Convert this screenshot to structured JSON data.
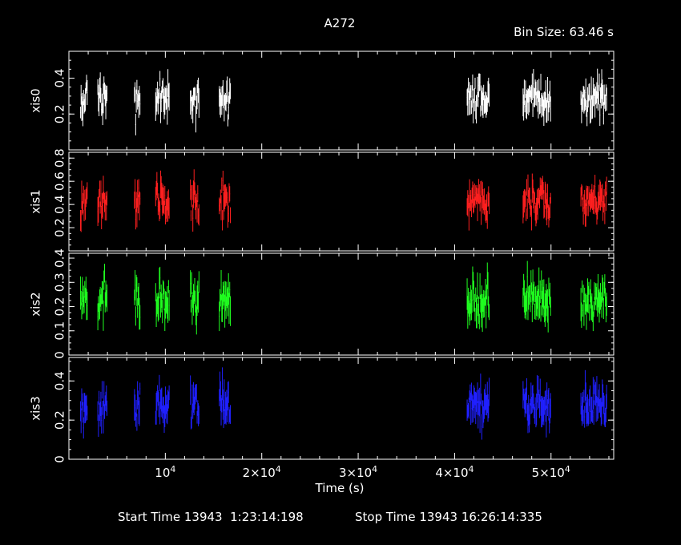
{
  "chart_data": {
    "type": "scatter",
    "title": "A272",
    "bin_size_label": "Bin Size: 63.46 s",
    "xlabel": "Time (s)",
    "x_tick_labels": [
      "10^4",
      "2×10^4",
      "3×10^4",
      "4×10^4",
      "5×10^4"
    ],
    "x_range": [
      0,
      56500
    ],
    "footer": {
      "start_label": "Start Time 13943  1:23:14:198",
      "stop_label": "Stop Time 13943 16:26:14:335"
    },
    "segments_s": [
      [
        1200,
        1900
      ],
      [
        3000,
        4000
      ],
      [
        6800,
        7400
      ],
      [
        9000,
        10400
      ],
      [
        12600,
        13500
      ],
      [
        15600,
        16800
      ],
      [
        41300,
        43600
      ],
      [
        47100,
        50000
      ],
      [
        53100,
        55800
      ]
    ],
    "panels": [
      {
        "name": "xis0",
        "color": "#ffffff",
        "ylim": [
          0.0,
          0.55
        ],
        "yticks": [
          0.2,
          0.4
        ],
        "ytick_labels": [
          "0.2",
          "0.4"
        ],
        "mean": 0.28,
        "spread": 0.06,
        "seed": 11
      },
      {
        "name": "xis1",
        "color": "#ff2020",
        "ylim": [
          0.0,
          0.85
        ],
        "yticks": [
          0.2,
          0.4,
          0.6,
          0.8
        ],
        "ytick_labels": [
          "0.2",
          "0.4",
          "0.6",
          "0.8"
        ],
        "mean": 0.42,
        "spread": 0.09,
        "seed": 23
      },
      {
        "name": "xis2",
        "color": "#20ff20",
        "ylim": [
          0.0,
          0.42
        ],
        "yticks": [
          0.0,
          0.1,
          0.2,
          0.3,
          0.4
        ],
        "ytick_labels": [
          "0",
          "0.1",
          "0.2",
          "0.3",
          "0.4"
        ],
        "mean": 0.23,
        "spread": 0.05,
        "seed": 37
      },
      {
        "name": "xis3",
        "color": "#2020ff",
        "ylim": [
          0.0,
          0.52
        ],
        "yticks": [
          0.0,
          0.2,
          0.4
        ],
        "ytick_labels": [
          "0",
          "0.2",
          "0.4"
        ],
        "mean": 0.27,
        "spread": 0.06,
        "seed": 51
      }
    ]
  }
}
